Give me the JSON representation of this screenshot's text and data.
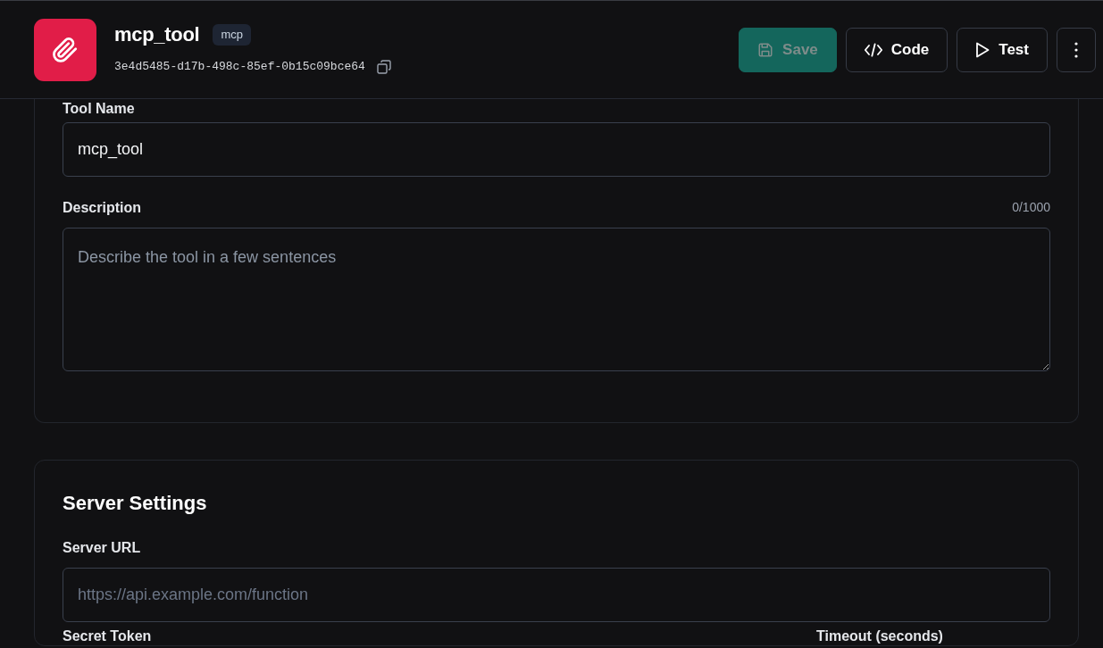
{
  "header": {
    "title": "mcp_tool",
    "badge": "mcp",
    "id": "3e4d5485-d17b-498c-85ef-0b15c09bce64",
    "buttons": [
      {
        "kind": "save",
        "label": "Save",
        "disabled": true
      },
      {
        "kind": "code",
        "label": "Code",
        "disabled": false
      },
      {
        "kind": "test",
        "label": "Test",
        "disabled": false
      },
      {
        "kind": "more",
        "disabled": false
      }
    ]
  },
  "sections": [
    {
      "fields": [
        {
          "kind": "input",
          "label": "Tool Name",
          "value": "mcp_tool"
        },
        {
          "kind": "textarea",
          "label": "Description",
          "counter": "0/1000",
          "placeholder": "Describe the tool in a few sentences"
        }
      ]
    },
    {
      "title": "Server Settings",
      "fields": [
        {
          "kind": "input",
          "label": "Server URL",
          "placeholder": "https://api.example.com/function"
        },
        {
          "kind": "labels",
          "labels": [
            "Secret Token",
            "Timeout (seconds)"
          ]
        }
      ]
    }
  ]
}
